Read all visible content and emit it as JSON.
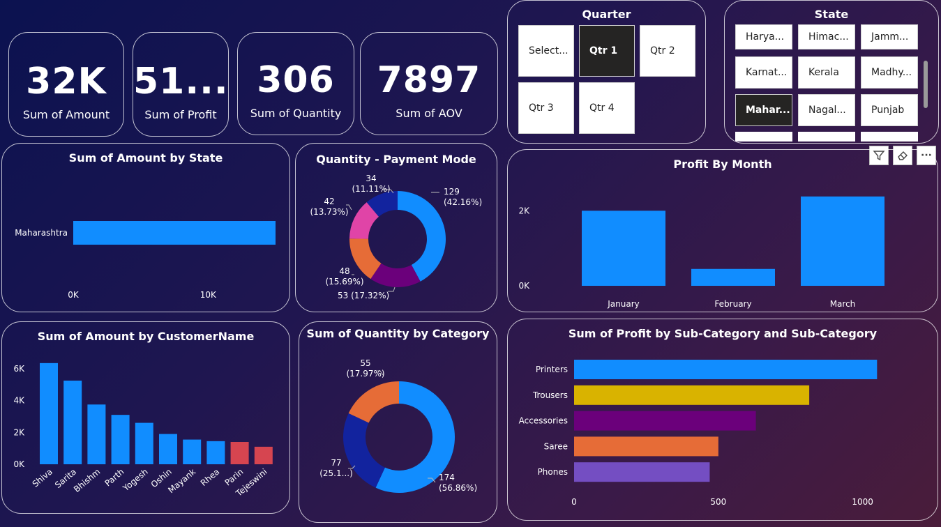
{
  "kpis": [
    {
      "value": "32K",
      "label": "Sum of Amount"
    },
    {
      "value": "51...",
      "label": "Sum of Profit"
    },
    {
      "value": "306",
      "label": "Sum of Quantity"
    },
    {
      "value": "7897",
      "label": "Sum of AOV"
    }
  ],
  "quarter_slicer": {
    "title": "Quarter",
    "options": [
      "Select...",
      "Qtr 1",
      "Qtr 2",
      "Qtr 3",
      "Qtr 4"
    ],
    "selected": "Qtr 1"
  },
  "state_slicer": {
    "title": "State",
    "options": [
      "Harya...",
      "Himac...",
      "Jamm...",
      "Karnat...",
      "Kerala",
      "Madhy...",
      "Mahar...",
      "Nagal...",
      "Punjab"
    ],
    "selected": "Mahar..."
  },
  "toolbar": {
    "filter_icon": "filter-icon",
    "eraser_icon": "eraser-icon",
    "more_label": "···"
  },
  "chart_data": [
    {
      "id": "amount_by_state",
      "type": "bar",
      "orientation": "horizontal",
      "title": "Sum of Amount by State",
      "categories": [
        "Maharashtra"
      ],
      "values": [
        15000
      ],
      "xlim": [
        0,
        15000
      ],
      "xticks": [
        "0K",
        "10K"
      ],
      "color": "#118dff"
    },
    {
      "id": "quantity_payment_mode",
      "type": "pie",
      "donut": true,
      "title": "Quantity - Payment Mode",
      "values": [
        129,
        53,
        48,
        42,
        34
      ],
      "labels": [
        "129\n(42.16%)",
        "53 (17.32%)",
        "48\n(15.69%)",
        "42\n(13.73%)",
        "34\n(11.11%)"
      ],
      "colors": [
        "#118dff",
        "#6b007b",
        "#e66c37",
        "#e044a7",
        "#12239e"
      ]
    },
    {
      "id": "profit_by_month",
      "type": "bar",
      "title": "Profit By Month",
      "categories": [
        "January",
        "February",
        "March"
      ],
      "values": [
        2000,
        450,
        2380
      ],
      "ylim": [
        0,
        2600
      ],
      "yticks": [
        "0K",
        "2K"
      ],
      "color": "#118dff"
    },
    {
      "id": "amount_by_customer",
      "type": "bar",
      "title": "Sum of Amount by CustomerName",
      "categories": [
        "Shiva",
        "Sarita",
        "Bhishm",
        "Parth",
        "Yogesh",
        "Oshin",
        "Mayank",
        "Rhea",
        "Parin",
        "Tejeswini"
      ],
      "values": [
        6350,
        5250,
        3750,
        3100,
        2600,
        1900,
        1550,
        1450,
        1400,
        1100
      ],
      "colors": [
        "#118dff",
        "#118dff",
        "#118dff",
        "#118dff",
        "#118dff",
        "#118dff",
        "#118dff",
        "#118dff",
        "#d64550",
        "#d64550"
      ],
      "ylim": [
        0,
        7000
      ],
      "yticks": [
        "0K",
        "2K",
        "4K",
        "6K"
      ]
    },
    {
      "id": "quantity_by_category",
      "type": "pie",
      "donut": true,
      "title": "Sum of Quantity by Category",
      "values": [
        174,
        77,
        55
      ],
      "labels": [
        "174\n(56.86%)",
        "77\n(25.1...)",
        "55\n(17.97%)"
      ],
      "colors": [
        "#118dff",
        "#12239e",
        "#e66c37"
      ]
    },
    {
      "id": "profit_by_subcategory",
      "type": "bar",
      "orientation": "horizontal",
      "title": "Sum of Profit by Sub-Category and Sub-Category",
      "categories": [
        "Printers",
        "Trousers",
        "Accessories",
        "Saree",
        "Phones"
      ],
      "values": [
        1050,
        815,
        630,
        500,
        470
      ],
      "colors": [
        "#118dff",
        "#d9b300",
        "#6b007b",
        "#e66c37",
        "#744ec2"
      ],
      "xlim": [
        0,
        1100
      ],
      "xticks": [
        "0",
        "500",
        "1000"
      ]
    }
  ]
}
